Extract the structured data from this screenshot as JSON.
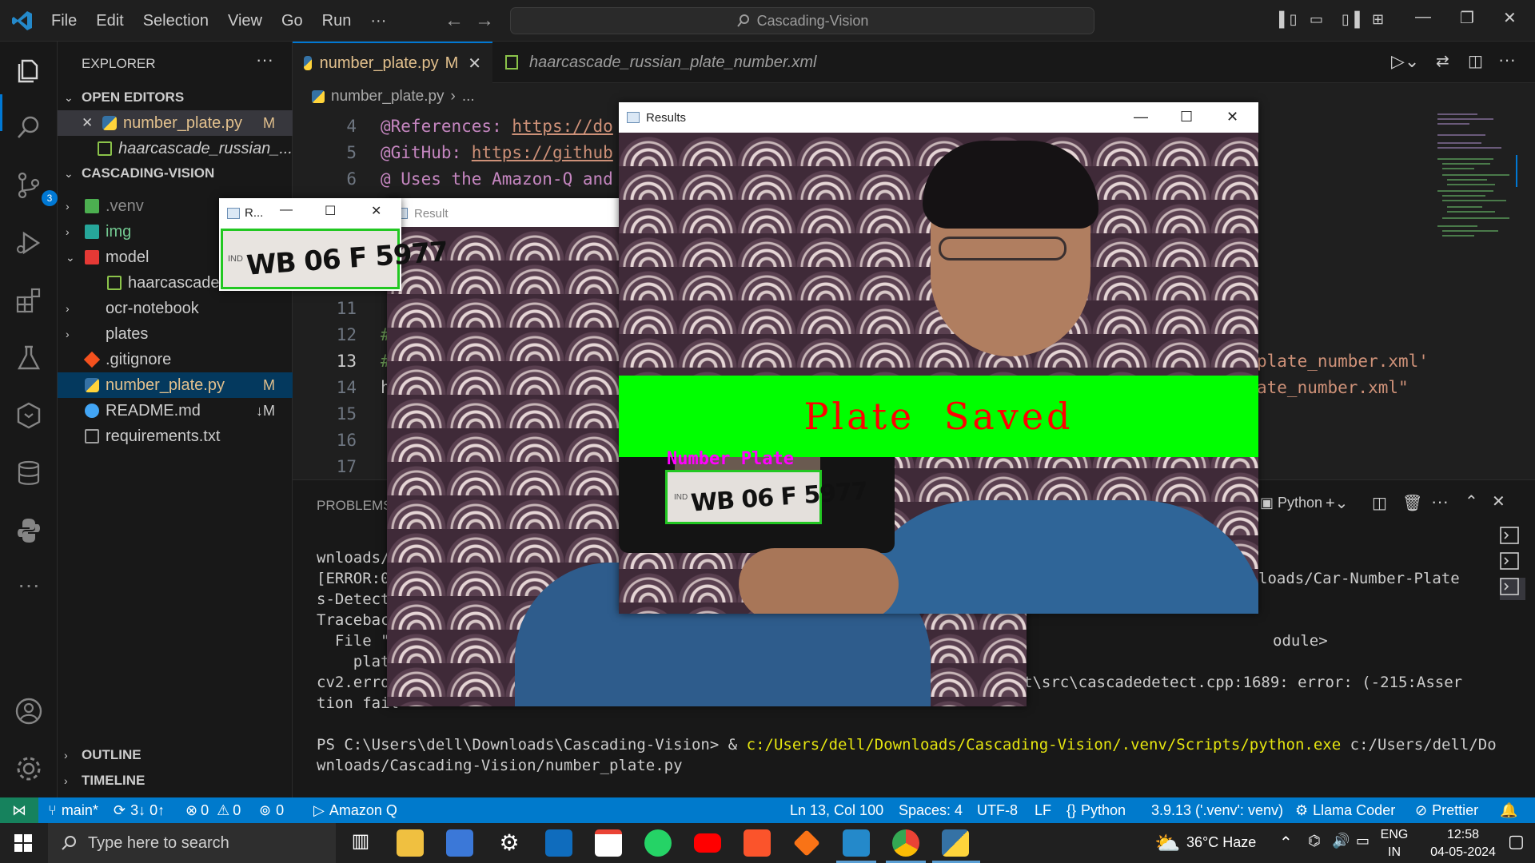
{
  "titlebar": {
    "menu": [
      "File",
      "Edit",
      "Selection",
      "View",
      "Go",
      "Run",
      "···"
    ],
    "search_text": "Cascading-Vision"
  },
  "activity_badge": "3",
  "explorer": {
    "header": "EXPLORER",
    "open_editors_title": "OPEN EDITORS",
    "open_editors": [
      {
        "name": "number_plate.py",
        "badge": "M"
      },
      {
        "name": "haarcascade_russian_..."
      }
    ],
    "project_title": "CASCADING-VISION",
    "tree": [
      {
        "name": ".venv"
      },
      {
        "name": "img"
      },
      {
        "name": "model"
      },
      {
        "name": "haarcascade"
      },
      {
        "name": "ocr-notebook"
      },
      {
        "name": "plates"
      },
      {
        "name": ".gitignore"
      },
      {
        "name": "number_plate.py",
        "badge": "M"
      },
      {
        "name": "README.md",
        "badge": "↓M"
      },
      {
        "name": "requirements.txt"
      }
    ],
    "outline_title": "OUTLINE",
    "timeline_title": "TIMELINE"
  },
  "tabs": [
    {
      "label": "number_plate.py",
      "badge": "M"
    },
    {
      "label": "haarcascade_russian_plate_number.xml"
    }
  ],
  "breadcrumb": {
    "file": "number_plate.py",
    "rest": "..."
  },
  "editor": {
    "lines": [
      {
        "num": "4",
        "label": "@References: ",
        "link": "https://do"
      },
      {
        "num": "5",
        "label": "@GitHub: ",
        "link": "https://github"
      },
      {
        "num": "6",
        "label": "@ Uses the Amazon-Q and"
      },
      {
        "num": "11"
      },
      {
        "num": "12",
        "text": "#"
      },
      {
        "num": "13",
        "text": "#"
      },
      {
        "num": "14",
        "text": "h"
      },
      {
        "num": "15"
      },
      {
        "num": "16"
      },
      {
        "num": "17"
      }
    ],
    "right_snippets": [
      "plate_number.xml'",
      "ate_number.xml\""
    ]
  },
  "panel": {
    "tab": "PROBLEMS",
    "terminal_kind": "Python",
    "lines": [
      "wnloads/",
      "[ERROR:0",
      "s-Detect",
      "Traceback",
      "  File \"",
      "    plat",
      "cv2.erro",
      "tion fail"
    ],
    "right_lines": [
      "loads/Car-Number-Plate",
      "odule>",
      "t\\src\\cascadedetect.cpp:1689: error: (-215:Asser"
    ],
    "prompt": "PS C:\\Users\\dell\\Downloads\\Cascading-Vision> & ",
    "python_path": "c:/Users/dell/Downloads/Cascading-Vision/.venv/Scripts/python.exe",
    "script_path": " c:/Users/dell/Do",
    "last_line": "wnloads/Cascading-Vision/number_plate.py"
  },
  "statusbar": {
    "branch": "main*",
    "sync": "3↓ 0↑",
    "errors": "0",
    "warnings": "0",
    "ports": "0",
    "amazon_q": "Amazon Q",
    "position": "Ln 13, Col 100",
    "spaces": "Spaces: 4",
    "encoding": "UTF-8",
    "eol": "LF",
    "language": "Python",
    "interpreter": "3.9.13 ('.venv': venv)",
    "llama": "Llama Coder",
    "prettier": "Prettier"
  },
  "cv_windows": {
    "small_title": "R...",
    "result_title": "Result",
    "results_title": "Results",
    "banner": "Plate Saved",
    "label": "Number Plate",
    "plate_text": "WB 06 F 5977",
    "plate_ind": "IND"
  },
  "taskbar": {
    "search_placeholder": "Type here to search",
    "weather": "36°C  Haze",
    "lang1": "ENG",
    "lang2": "IN",
    "time": "12:58",
    "date": "04-05-2024"
  }
}
